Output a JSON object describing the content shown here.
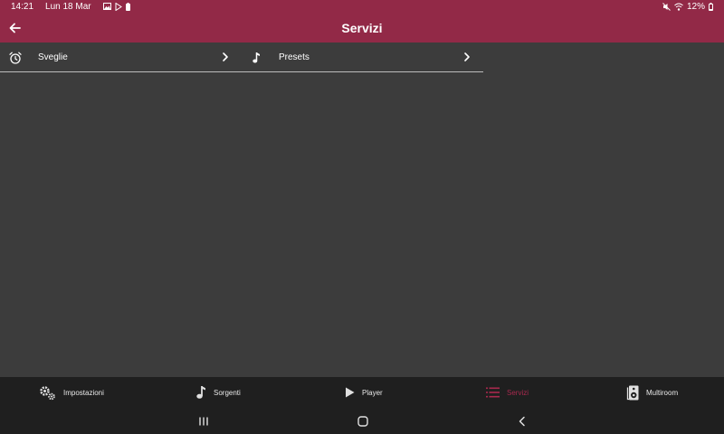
{
  "status_bar": {
    "time": "14:21",
    "date": "Lun 18 Mar",
    "battery": "12%"
  },
  "header": {
    "title": "Servizi"
  },
  "services": [
    {
      "label": "Sveglie",
      "icon": "alarm-clock-icon"
    },
    {
      "label": "Presets",
      "icon": "music-note-icon"
    }
  ],
  "bottom_nav": {
    "items": [
      {
        "label": "Impostazioni",
        "icon": "gears-icon"
      },
      {
        "label": "Sorgenti",
        "icon": "music-note-icon"
      },
      {
        "label": "Player",
        "icon": "play-icon"
      },
      {
        "label": "Servizi",
        "icon": "list-icon",
        "active": true
      },
      {
        "label": "Multiroom",
        "icon": "speaker-icon"
      }
    ],
    "active_color": "#a8294e"
  },
  "colors": {
    "header_bg": "#922947",
    "content_bg": "#3c3c3c",
    "nav_bg": "#1f1f1f"
  }
}
